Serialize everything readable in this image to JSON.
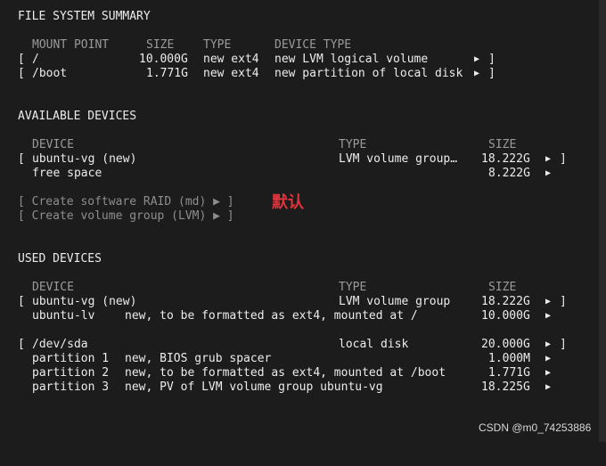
{
  "fs_summary": {
    "title": "FILE SYSTEM SUMMARY",
    "headers": [
      "MOUNT POINT",
      "SIZE",
      "TYPE",
      "DEVICE TYPE"
    ],
    "rows": [
      {
        "open": "[",
        "mount": "/",
        "size": "10.000G",
        "type": "new ext4",
        "devtype": "new LVM logical volume",
        "arrow": "▶",
        "close": "]"
      },
      {
        "open": "[",
        "mount": "/boot",
        "size": "1.771G",
        "type": "new ext4",
        "devtype": "new partition of local disk",
        "arrow": "▶",
        "close": "]"
      }
    ]
  },
  "available": {
    "title": "AVAILABLE DEVICES",
    "headers": [
      "DEVICE",
      "TYPE",
      "SIZE"
    ],
    "rows": [
      {
        "open": "[",
        "device": "ubuntu-vg (new)",
        "type": "LVM volume group…",
        "size": "18.222G",
        "arrow": "▶",
        "close": "]"
      },
      {
        "device": "free space",
        "size": "8.222G",
        "arrow": "▶"
      }
    ],
    "actions": [
      {
        "label": "[ Create software RAID (md) ▶ ]"
      },
      {
        "label": "[ Create volume group (LVM) ▶ ]"
      }
    ]
  },
  "annotation": "默认",
  "used": {
    "title": "USED DEVICES",
    "headers": [
      "DEVICE",
      "TYPE",
      "SIZE"
    ],
    "groups": [
      {
        "open": "[",
        "device": "ubuntu-vg (new)",
        "type": "LVM volume group",
        "size": "18.222G",
        "arrow": "▶",
        "close": "]",
        "children": [
          {
            "name": "ubuntu-lv",
            "desc": "new, to be formatted as ext4, mounted at /",
            "size": "10.000G",
            "arrow": "▶"
          }
        ]
      },
      {
        "open": "[",
        "device": "/dev/sda",
        "type": "local disk",
        "size": "20.000G",
        "arrow": "▶",
        "close": "]",
        "children": [
          {
            "name": "partition 1",
            "desc": "new, BIOS grub spacer",
            "size": "1.000M",
            "arrow": "▶"
          },
          {
            "name": "partition 2",
            "desc": "new, to be formatted as ext4, mounted at /boot",
            "size": "1.771G",
            "arrow": "▶"
          },
          {
            "name": "partition 3",
            "desc": "new, PV of LVM volume group ubuntu-vg",
            "size": "18.225G",
            "arrow": "▶"
          }
        ]
      }
    ]
  },
  "watermark": "CSDN @m0_74253886"
}
